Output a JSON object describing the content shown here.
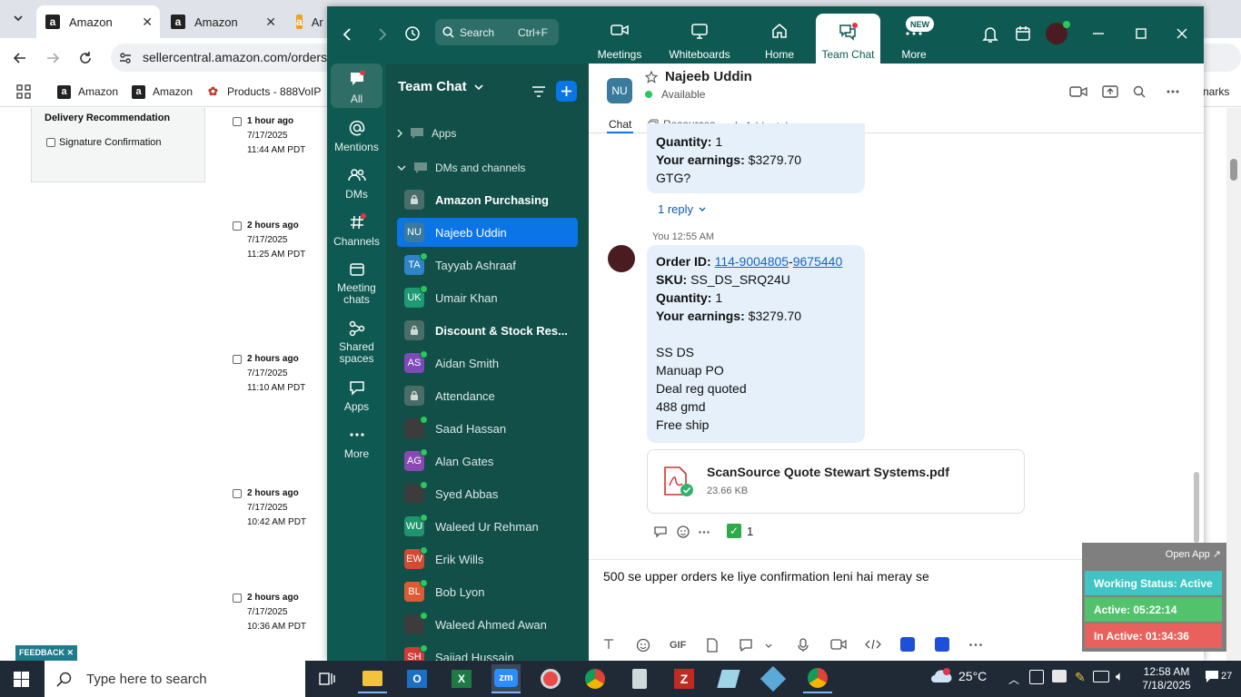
{
  "browser": {
    "tabs": [
      {
        "title": "Amazon",
        "active": true
      },
      {
        "title": "Amazon",
        "active": false
      },
      {
        "title": "Ar",
        "active": false
      }
    ],
    "url": "sellercentral.amazon.com/orders-",
    "bookmarks": [
      {
        "label": "Amazon"
      },
      {
        "label": "Amazon"
      },
      {
        "label": "Products - 888VoIP"
      }
    ],
    "bookmarks_right": "narks"
  },
  "seller_page": {
    "delivery_title": "Delivery Recommendation",
    "signature": "Signature Confirmation",
    "orders": [
      {
        "relative": "1 hour ago",
        "date": "7/17/2025",
        "time": "11:44 AM PDT"
      },
      {
        "relative": "2 hours ago",
        "date": "7/17/2025",
        "time": "11:25 AM PDT"
      },
      {
        "relative": "2 hours ago",
        "date": "7/17/2025",
        "time": "11:10 AM PDT"
      },
      {
        "relative": "2 hours ago",
        "date": "7/17/2025",
        "time": "10:42 AM PDT"
      },
      {
        "relative": "2 hours ago",
        "date": "7/17/2025",
        "time": "10:36 AM PDT"
      }
    ],
    "feedback": "FEEDBACK ✕"
  },
  "zoom": {
    "search": {
      "label": "Search",
      "shortcut": "Ctrl+F"
    },
    "nav": [
      {
        "label": "Meetings",
        "icon": "video-icon"
      },
      {
        "label": "Whiteboards",
        "icon": "whiteboard-icon"
      },
      {
        "label": "Home",
        "icon": "home-icon"
      },
      {
        "label": "Team Chat",
        "icon": "chat-icon",
        "active": true
      },
      {
        "label": "More",
        "icon": "more-icon"
      }
    ],
    "new_badge": "NEW",
    "rail": [
      {
        "label": "All",
        "icon": "chat-bubble-icon"
      },
      {
        "label": "Mentions",
        "icon": "at-icon"
      },
      {
        "label": "DMs",
        "icon": "people-icon"
      },
      {
        "label": "Channels",
        "icon": "hash-icon"
      },
      {
        "label": "Meeting chats",
        "icon": "calendar-icon"
      },
      {
        "label": "Shared spaces",
        "icon": "share-icon"
      },
      {
        "label": "Apps",
        "icon": "apps-icon"
      },
      {
        "label": "More",
        "icon": "ellipsis-icon"
      }
    ],
    "panel_title": "Team Chat",
    "apps_label": "Apps",
    "dms_label": "DMs and channels",
    "contacts": [
      {
        "name": "Amazon Purchasing",
        "kind": "lock",
        "bold": true
      },
      {
        "name": "Najeeb Uddin",
        "kind": "avatar",
        "initials": "NU",
        "color": "#3a7a9c",
        "selected": true
      },
      {
        "name": "Tayyab Ashraaf",
        "kind": "avatar",
        "initials": "TA",
        "color": "#2e84c6",
        "online": true
      },
      {
        "name": "Umair Khan",
        "kind": "avatar",
        "initials": "UK",
        "color": "#1d9a72",
        "online": true
      },
      {
        "name": "Discount & Stock Res...",
        "kind": "lock",
        "bold": true
      },
      {
        "name": "Aidan Smith",
        "kind": "avatar",
        "initials": "AS",
        "color": "#7c4bb8",
        "online": true
      },
      {
        "name": "Attendance",
        "kind": "lock"
      },
      {
        "name": "Saad Hassan",
        "kind": "photo",
        "online": true
      },
      {
        "name": "Alan Gates",
        "kind": "avatar",
        "initials": "AG",
        "color": "#8a49b2",
        "online": true
      },
      {
        "name": "Syed Abbas",
        "kind": "photo",
        "online": true
      },
      {
        "name": "Waleed Ur Rehman",
        "kind": "avatar",
        "initials": "WU",
        "color": "#20956d",
        "online": true
      },
      {
        "name": "Erik Wills",
        "kind": "avatar",
        "initials": "EW",
        "color": "#d24a33",
        "online": true
      },
      {
        "name": "Bob Lyon",
        "kind": "avatar",
        "initials": "BL",
        "color": "#dd5b34",
        "online": true
      },
      {
        "name": "Waleed Ahmed Awan",
        "kind": "photo",
        "online": true
      },
      {
        "name": "Sajjad Hussain",
        "kind": "avatar",
        "initials": "SH",
        "color": "#d23a3a",
        "online": true
      }
    ],
    "chat": {
      "contact_initials": "NU",
      "contact_name": "Najeeb Uddin",
      "status": "Available",
      "tabs": [
        "Chat",
        "Resources",
        "Add a tab"
      ],
      "msg1": {
        "quantity_label": "Quantity:",
        "quantity": "1",
        "earnings_label": "Your earnings:",
        "earnings": "$3279.70",
        "note": "GTG?"
      },
      "reply_count": "1 reply",
      "msg2_meta": "You 12:55 AM",
      "msg2": {
        "order_label": "Order ID:",
        "order_id_a": "114-9004805",
        "order_id_sep": "-",
        "order_id_b": "9675440",
        "sku_label": "SKU:",
        "sku": "SS_DS_SRQ24U",
        "quantity_label": "Quantity:",
        "quantity": "1",
        "earnings_label": "Your earnings:",
        "earnings": "$3279.70",
        "lines": [
          "SS DS",
          "Manuap PO",
          "Deal reg quoted",
          "488 gmd",
          "Free ship"
        ]
      },
      "file": {
        "name": "ScanSource Quote Stewart Systems.pdf",
        "size": "23.66 KB"
      },
      "reaction_count": "1",
      "composer_text": "500 se upper orders ke liye confirmation leni hai meray se"
    }
  },
  "widget": {
    "open_app": "Open App ↗",
    "working_status": "Working Status: Active",
    "active": "Active: 05:22:14",
    "inactive": "In Active: 01:34:36",
    "colors": {
      "working": "#40c4c4",
      "active": "#52c26c",
      "inactive": "#e8615c"
    }
  },
  "taskbar": {
    "search_placeholder": "Type here to search",
    "weather": "25°C",
    "time": "12:58 AM",
    "date": "7/18/2025",
    "notifications": "27"
  }
}
